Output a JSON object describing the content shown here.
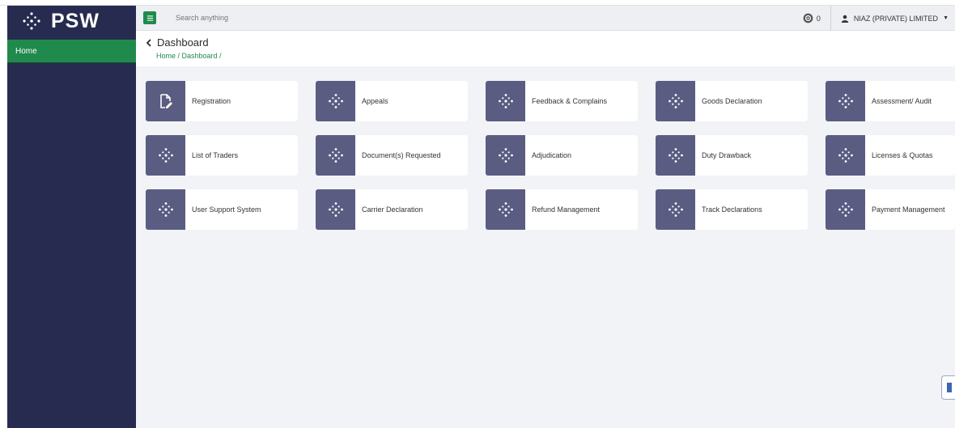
{
  "brand": {
    "name": "PSW",
    "logo_icon": "psw-diamond-dots-icon"
  },
  "sidebar": {
    "items": [
      {
        "label": "Home",
        "active": true
      }
    ]
  },
  "topbar": {
    "menu_icon": "hamburger-icon",
    "search": {
      "placeholder": "Search anything",
      "value": ""
    },
    "notifications": {
      "icon": "notification-icon",
      "count": "0"
    },
    "user": {
      "icon": "user-icon",
      "name": "NIAZ (PRIVATE) LIMITED",
      "caret_icon": "caret-down-icon"
    }
  },
  "page": {
    "title": "Dashboard",
    "back_icon": "chevron-left-icon",
    "breadcrumb": "Home / Dashboard /"
  },
  "tiles": [
    {
      "label": "Registration",
      "icon": "edit-document-icon"
    },
    {
      "label": "Appeals",
      "icon": "psw-diamond-dots-icon"
    },
    {
      "label": "Feedback & Complains",
      "icon": "psw-diamond-dots-icon"
    },
    {
      "label": "Goods Declaration",
      "icon": "psw-diamond-dots-icon"
    },
    {
      "label": "Assessment/ Audit",
      "icon": "psw-diamond-dots-icon"
    },
    {
      "label": "List of Traders",
      "icon": "psw-diamond-dots-icon"
    },
    {
      "label": "Document(s) Requested",
      "icon": "psw-diamond-dots-icon"
    },
    {
      "label": "Adjudication",
      "icon": "psw-diamond-dots-icon"
    },
    {
      "label": "Duty Drawback",
      "icon": "psw-diamond-dots-icon"
    },
    {
      "label": "Licenses & Quotas",
      "icon": "psw-diamond-dots-icon"
    },
    {
      "label": "User Support System",
      "icon": "psw-diamond-dots-icon"
    },
    {
      "label": "Carrier Declaration",
      "icon": "psw-diamond-dots-icon"
    },
    {
      "label": "Refund Management",
      "icon": "psw-diamond-dots-icon"
    },
    {
      "label": "Track Declarations",
      "icon": "psw-diamond-dots-icon"
    },
    {
      "label": "Payment Management",
      "icon": "psw-diamond-dots-icon"
    }
  ],
  "colors": {
    "sidebar": "#262b4f",
    "accent": "#1f8a4c",
    "tile": "#5a5c82",
    "background": "#f2f3f7"
  },
  "floating_button": {
    "icon": "feedback-flag-icon"
  }
}
